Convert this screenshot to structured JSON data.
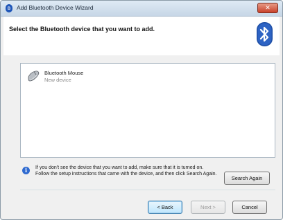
{
  "window": {
    "title": "Add Bluetooth Device Wizard",
    "close_glyph": "✕"
  },
  "header": {
    "instruction": "Select the Bluetooth device that you want to add."
  },
  "devices": [
    {
      "name": "Bluetooth Mouse",
      "status": "New device",
      "icon": "mouse-icon"
    }
  ],
  "info": {
    "glyph": "i",
    "text": "If you don't see the device that you want to add, make sure that it is turned on. Follow the setup instructions that came with the device, and then click Search Again."
  },
  "buttons": {
    "search_again": "Search Again",
    "back": "< Back",
    "next": "Next >",
    "cancel": "Cancel"
  },
  "colors": {
    "accent": "#1f56b8",
    "close": "#c8412a"
  }
}
